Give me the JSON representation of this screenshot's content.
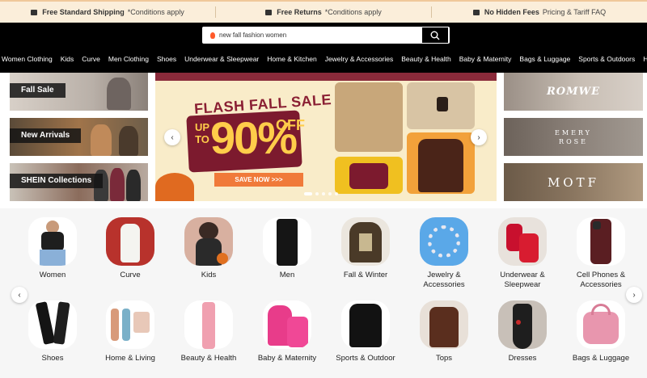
{
  "promo": [
    {
      "icon": "truck-icon",
      "title": "Free Standard Shipping",
      "sub": "*Conditions apply"
    },
    {
      "icon": "return-box-icon",
      "title": "Free Returns",
      "sub": "*Conditions apply"
    },
    {
      "icon": "receipt-icon",
      "title": "No Hidden Fees",
      "sub": "Pricing & Tariff FAQ"
    }
  ],
  "search": {
    "placeholder": "new fall fashion women"
  },
  "nav": [
    "Women Clothing",
    "Kids",
    "Curve",
    "Men Clothing",
    "Shoes",
    "Underwear & Sleepwear",
    "Home & Kitchen",
    "Jewelry & Accessories",
    "Beauty & Health",
    "Baby & Maternity",
    "Bags & Luggage",
    "Sports & Outdoors",
    "Home Textil"
  ],
  "side_tiles": [
    "Fall Sale",
    "New Arrivals",
    "SHEIN Collections"
  ],
  "hero": {
    "title": "FLASH FALL SALE",
    "upto": "UP TO",
    "percent": "90%",
    "off": "OFF",
    "cta": "SAVE NOW >>>"
  },
  "brands": [
    "ROMWE",
    "EMERY ROSE",
    "MOTF"
  ],
  "categories_row1": [
    "Women",
    "Curve",
    "Kids",
    "Men",
    "Fall & Winter",
    "Jewelry & Accessories",
    "Underwear & Sleepwear",
    "Cell Phones & Accessories"
  ],
  "categories_row2": [
    "Shoes",
    "Home & Living",
    "Beauty & Health",
    "Baby & Maternity",
    "Sports & Outdoor",
    "Tops",
    "Dresses",
    "Bags & Luggage"
  ],
  "colors": {
    "accent": "#7c1a2e",
    "promo_bg": "#fbeeda",
    "header": "#000000",
    "cta": "#f07a3a"
  }
}
